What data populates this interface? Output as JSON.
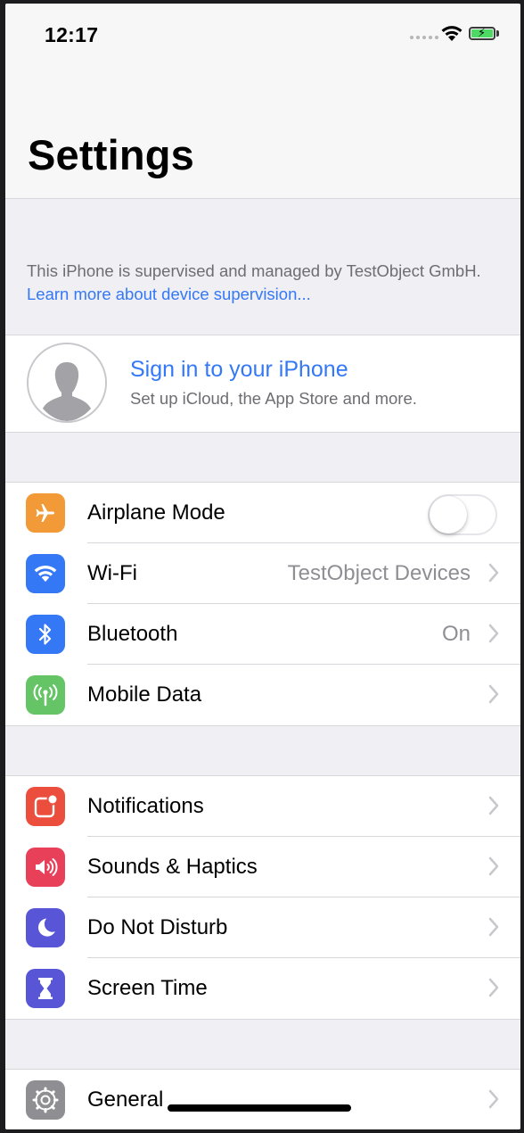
{
  "status_bar": {
    "time": "12:17"
  },
  "header": {
    "title": "Settings"
  },
  "supervision": {
    "text": "This iPhone is supervised and managed by TestObject GmbH.",
    "link": "Learn more about device supervision..."
  },
  "profile": {
    "title": "Sign in to your iPhone",
    "subtitle": "Set up iCloud, the App Store and more."
  },
  "connectivity": {
    "airplane": {
      "label": "Airplane Mode",
      "enabled": false,
      "icon": "airplane-icon",
      "color": "#f19a37"
    },
    "wifi": {
      "label": "Wi-Fi",
      "value": "TestObject Devices",
      "icon": "wifi-icon",
      "color": "#3478f6"
    },
    "bluetooth": {
      "label": "Bluetooth",
      "value": "On",
      "icon": "bluetooth-icon",
      "color": "#3478f6"
    },
    "mobile_data": {
      "label": "Mobile Data",
      "icon": "antenna-icon",
      "color": "#65c466"
    }
  },
  "alerts": {
    "notifications": {
      "label": "Notifications",
      "icon": "notifications-icon",
      "color": "#eb4e3d"
    },
    "sounds": {
      "label": "Sounds & Haptics",
      "icon": "speaker-icon",
      "color": "#e9405a"
    },
    "dnd": {
      "label": "Do Not Disturb",
      "icon": "moon-icon",
      "color": "#5856d6"
    },
    "screen_time": {
      "label": "Screen Time",
      "icon": "hourglass-icon",
      "color": "#5856d6"
    }
  },
  "system": {
    "general": {
      "label": "General",
      "icon": "gear-icon",
      "color": "#8e8e93"
    }
  }
}
